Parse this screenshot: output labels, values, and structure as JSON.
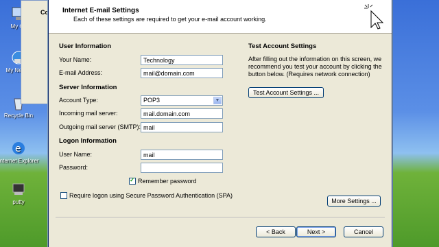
{
  "desktop": {
    "icons": [
      {
        "label": "My Co",
        "icon": "my-computer-icon"
      },
      {
        "label": "My Ne Pla",
        "icon": "my-network-places-icon"
      },
      {
        "label": "Recycle Bin",
        "icon": "recycle-bin-icon"
      },
      {
        "label": "Internet Explorer",
        "icon": "internet-explorer-icon"
      },
      {
        "label": "putty",
        "icon": "putty-icon"
      }
    ],
    "bg_window_fragment": "Co"
  },
  "dialog": {
    "title": "Internet E-mail Settings",
    "subtitle": "Each of these settings are required to get your e-mail account working.",
    "user_info": {
      "heading": "User Information",
      "name_label": "Your Name:",
      "name_value": "Technology",
      "email_label": "E-mail Address:",
      "email_value": "mail@domain.com"
    },
    "server_info": {
      "heading": "Server Information",
      "account_type_label": "Account Type:",
      "account_type_value": "POP3",
      "incoming_label": "Incoming mail server:",
      "incoming_value": "mail.domain.com",
      "outgoing_label": "Outgoing mail server (SMTP):",
      "outgoing_value": "mail"
    },
    "logon_info": {
      "heading": "Logon Information",
      "username_label": "User Name:",
      "username_value": "mail",
      "password_label": "Password:",
      "password_value": "",
      "remember_label": "Remember password",
      "remember_checked": true,
      "spa_label": "Require logon using Secure Password Authentication (SPA)",
      "spa_checked": false
    },
    "test": {
      "heading": "Test Account Settings",
      "description": "After filling out the information on this screen, we recommend you test your account by clicking the button below. (Requires network connection)",
      "button": "Test Account Settings ..."
    },
    "more_settings": "More Settings ...",
    "back": "< Back",
    "next": "Next >",
    "cancel": "Cancel"
  }
}
